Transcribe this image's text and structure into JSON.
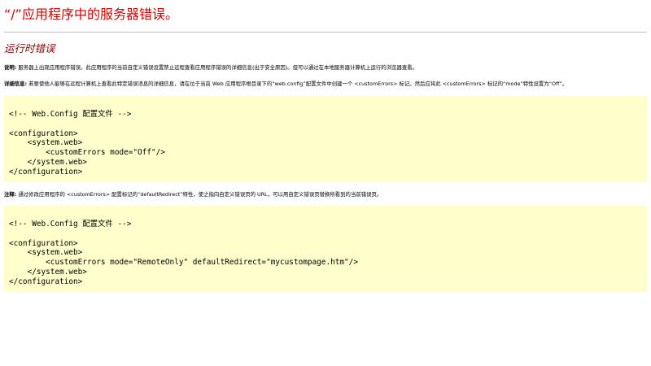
{
  "page": {
    "title": "“/”应用程序中的服务器错误。"
  },
  "error": {
    "heading": "运行时错误",
    "description_label": "说明:",
    "description_text": " 服务器上出现应用程序错误。此应用程序的当前自定义错误设置禁止远程查看应用程序错误的详细信息(出于安全原因)。但可以通过在本地服务器计算机上运行的浏览器查看。",
    "details_label": "详细信息:",
    "details_text": " 若要使他人能够在远程计算机上查看此特定错误消息的详细信息，请在位于当前 Web 应用程序根目录下的“web.config”配置文件中创建一个 <customErrors> 标记。然后应将此 <customErrors> 标记的“mode”特性设置为“Off”。",
    "code_sample_1": "<!-- Web.Config 配置文件 -->\n\n<configuration>\n    <system.web>\n        <customErrors mode=\"Off\"/>\n    </system.web>\n</configuration>",
    "notes_label": "注释:",
    "notes_text": " 通过修改应用程序的 <customErrors> 配置标记的“defaultRedirect”特性，使之指向自定义错误页的 URL，可以用自定义错误页替换所看到的当前错误页。",
    "code_sample_2": "<!-- Web.Config 配置文件 -->\n\n<configuration>\n    <system.web>\n        <customErrors mode=\"RemoteOnly\" defaultRedirect=\"mycustompage.htm\"/>\n    </system.web>\n</configuration>"
  },
  "colors": {
    "title": "#cc0000",
    "heading": "#800000",
    "code_background": "#ffffcc",
    "rule": "#c0c0c0"
  }
}
